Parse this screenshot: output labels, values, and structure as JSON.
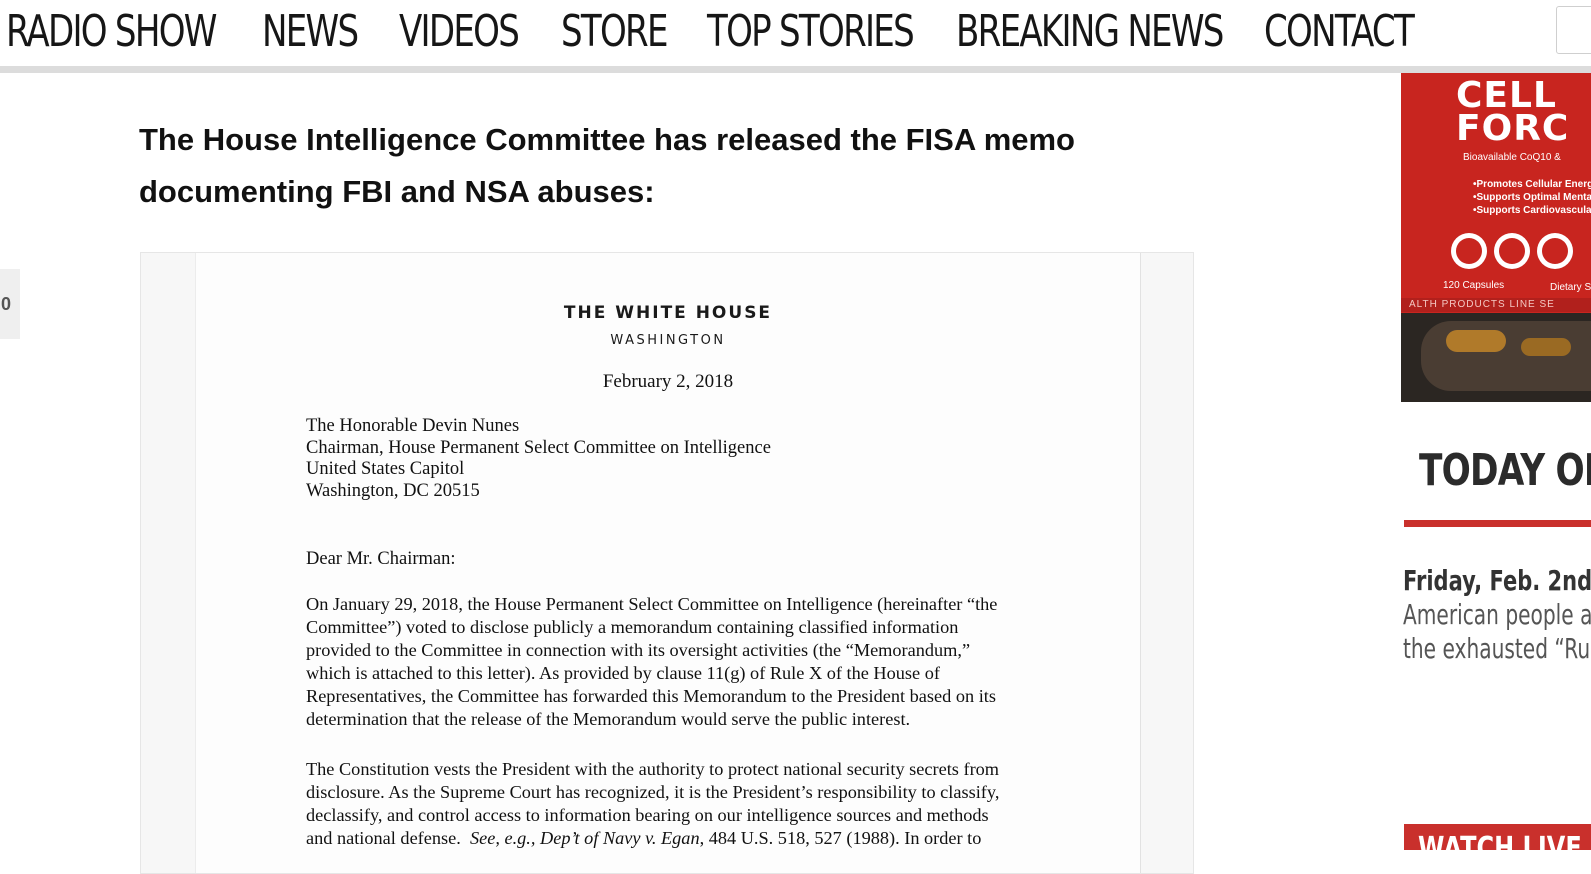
{
  "nav": {
    "items": [
      "RADIO SHOW",
      "NEWS",
      "VIDEOS",
      "STORE",
      "TOP STORIES",
      "BREAKING NEWS",
      "CONTACT"
    ]
  },
  "article": {
    "headline_line1": "The House Intelligence Committee has released the FISA memo",
    "headline_line2": "documenting FBI and NSA abuses:"
  },
  "share": {
    "count": "0"
  },
  "document": {
    "title": "THE WHITE HOUSE",
    "subtitle": "WASHINGTON",
    "date": "February 2, 2018",
    "address": [
      "The Honorable Devin Nunes",
      "Chairman, House Permanent Select Committee on Intelligence",
      "United States Capitol",
      "Washington, DC 20515"
    ],
    "salutation": "Dear Mr. Chairman:",
    "paragraph1": [
      "On January 29, 2018, the House Permanent Select Committee on Intelligence (hereinafter “the",
      "Committee”) voted to disclose publicly a memorandum containing classified information",
      "provided to the Committee in connection with its oversight activities (the “Memorandum,”",
      "which is attached to this letter).  As provided by clause 11(g) of Rule X of the House of",
      "Representatives, the Committee has forwarded this Memorandum to the President based on its",
      "determination that the release of the Memorandum would serve the public interest."
    ],
    "paragraph2": [
      "The Constitution vests the President with the authority to protect national security secrets from",
      "disclosure.  As the Supreme Court has recognized, it is the President’s responsibility to classify,",
      "declassify, and control access to information bearing on our intelligence sources and methods"
    ],
    "paragraph2_last": {
      "start": "and national defense.  ",
      "italic": "See, e.g., Dep’t of Navy v. Egan",
      "end": ", 484 U.S. 518, 527 (1988).  In order to"
    }
  },
  "ad": {
    "title_line1": "CELL",
    "title_line2": "FORC",
    "subtitle": "Bioavailable CoQ10 &",
    "bullets": [
      "•Promotes Cellular Energy Pr",
      "•Supports Optimal Mental He",
      "•Supports Cardiovascular He"
    ],
    "capsules": "120 Capsules",
    "dietary": "Dietary S",
    "band": "ALTH PRODUCTS LINE SE",
    "colors": {
      "red": "#c8251f"
    }
  },
  "sidebar": {
    "heading": "TODAY ON",
    "date": "Friday, Feb. 2nd",
    "text_line1": "American people ar",
    "text_line2": "the exhausted “Rus",
    "watch": "WATCH LIVE"
  },
  "colors": {
    "accent": "#c9302c"
  }
}
